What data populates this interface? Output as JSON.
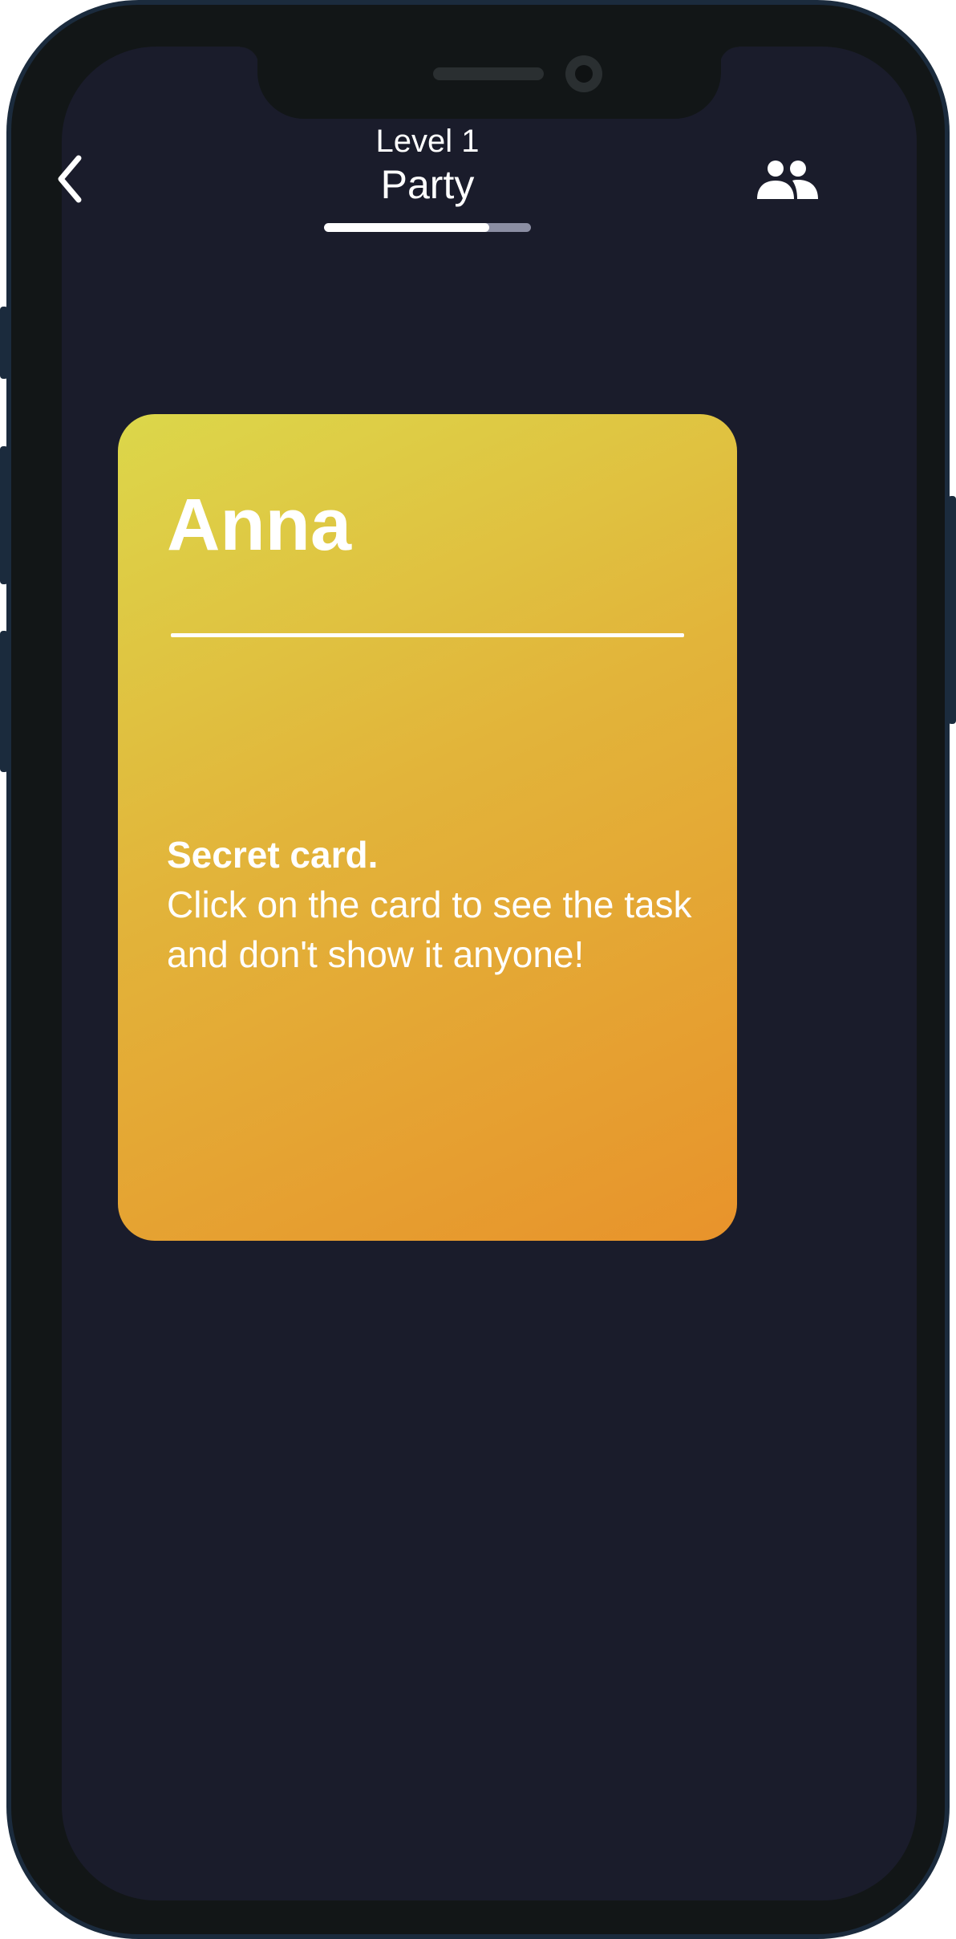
{
  "header": {
    "level_label": "Level 1",
    "mode_title": "Party",
    "progress_fraction": 0.8,
    "back_icon": "chevron-left-icon",
    "players_icon": "users-icon"
  },
  "card": {
    "player_name": "Anna",
    "title": "Secret card.",
    "body": "Click on the card to see the task and don't show it anyone!"
  },
  "colors": {
    "screen_background": "#1a1c2b",
    "card_gradient_start": "#dcd74a",
    "card_gradient_end": "#e8932b",
    "progress_track": "#8b8ea3",
    "progress_fill": "#ffffff"
  }
}
